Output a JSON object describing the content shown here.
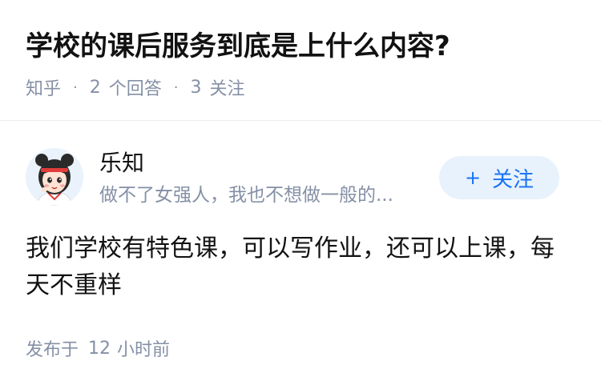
{
  "question": {
    "title": "学校的课后服务到底是上什么内容?"
  },
  "meta": {
    "source": "知乎",
    "answer_count": "2",
    "answer_label": "个回答",
    "follower_count": "3",
    "follower_label": "关注",
    "separator": "·"
  },
  "author": {
    "name": "乐知",
    "bio": "做不了女强人，我也不想做一般的...",
    "avatar_icon": "cartoon-girl-avatar"
  },
  "follow_button": {
    "plus": "+",
    "label": "关注"
  },
  "answer": {
    "content": "我们学校有特色课，可以写作业，还可以上课，每天不重样"
  },
  "publish": {
    "prefix": "发布于",
    "count": "12",
    "unit": "小时前"
  },
  "colors": {
    "primary_text": "#121212",
    "secondary_text": "#8590a6",
    "accent": "#1772f6",
    "follow_bg": "#e8f2fc",
    "divider": "#ebebeb"
  }
}
